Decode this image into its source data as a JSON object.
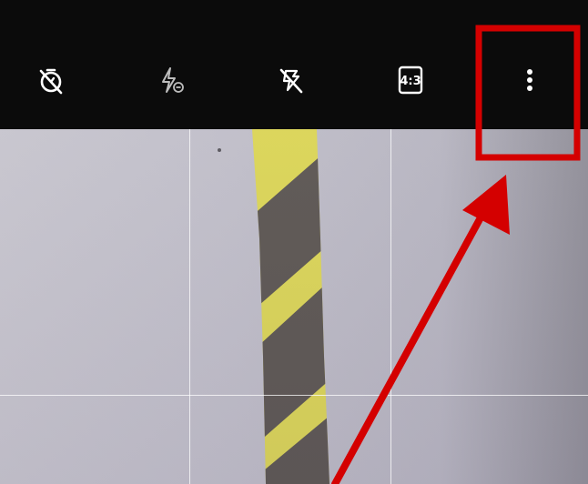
{
  "toolbar": {
    "timer_icon": "timer-off-icon",
    "flash_icon": "flash-auto-icon",
    "motion_icon": "motion-photo-off-icon",
    "aspect_ratio_label": "4:3",
    "more_icon": "more-vert-icon"
  },
  "annotation": {
    "highlight_color": "#d40000"
  }
}
